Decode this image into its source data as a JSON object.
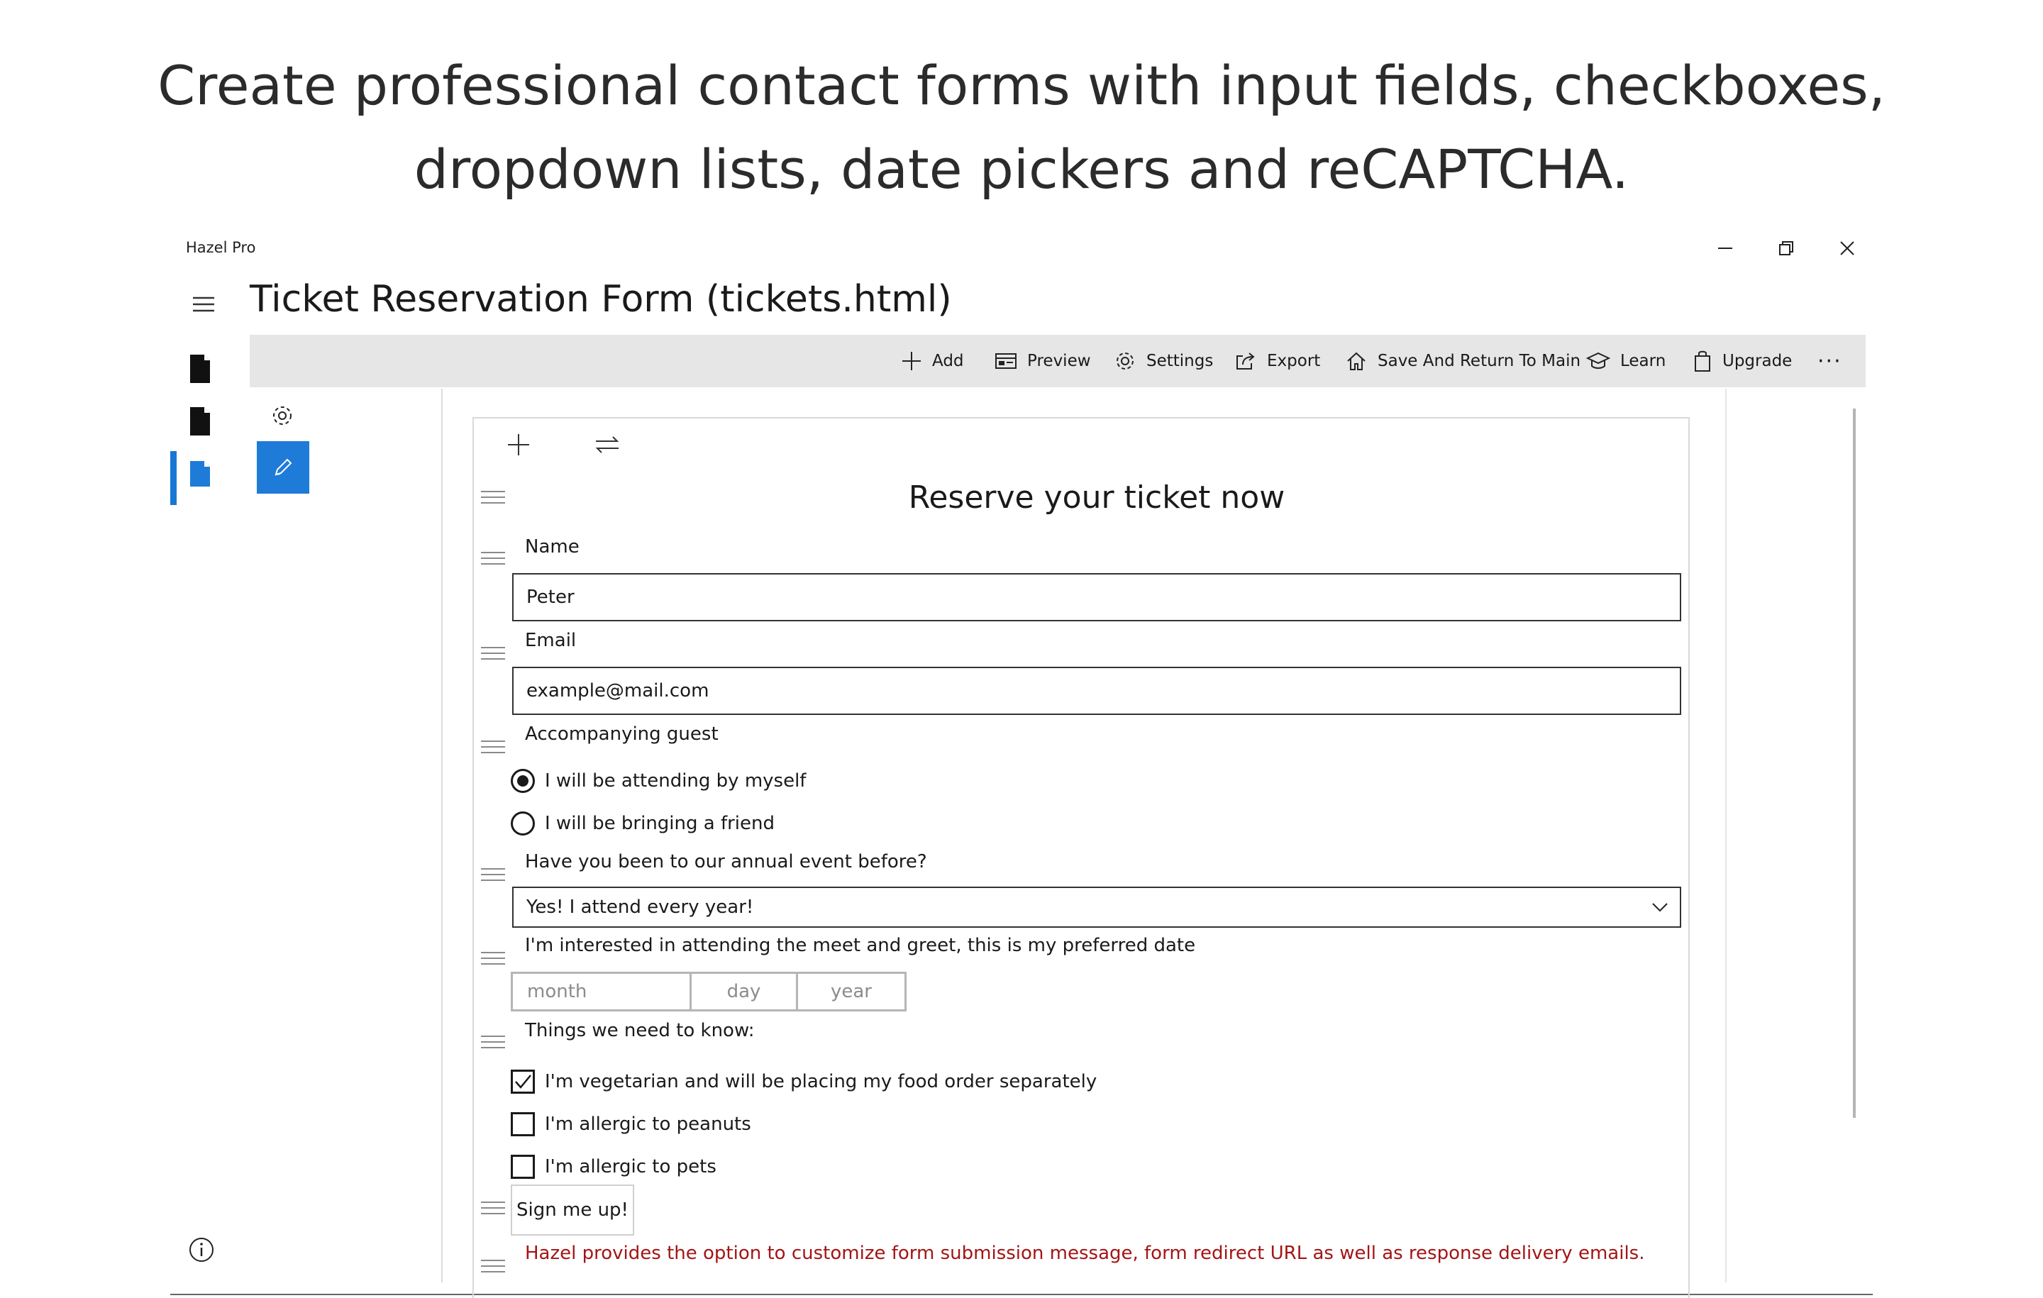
{
  "headline": {
    "line1": "Create professional contact forms with input fields, checkboxes,",
    "line2": "dropdown lists, date pickers and reCAPTCHA."
  },
  "window": {
    "app_title": "Hazel Pro",
    "page_title": "Ticket Reservation Form (tickets.html)"
  },
  "toolbar": {
    "add": "Add",
    "preview": "Preview",
    "settings": "Settings",
    "export": "Export",
    "save_return": "Save And Return To Main",
    "learn": "Learn",
    "upgrade": "Upgrade",
    "more": "···"
  },
  "form": {
    "title": "Reserve your ticket now",
    "name": {
      "label": "Name",
      "value": "Peter"
    },
    "email": {
      "label": "Email",
      "value": "example@mail.com"
    },
    "guest": {
      "label": "Accompanying guest",
      "options": [
        "I will be attending by myself",
        "I will be bringing a friend"
      ],
      "selected": 0
    },
    "event": {
      "label": "Have you been to our annual event before?",
      "selected": "Yes! I attend every year!"
    },
    "date": {
      "label": "I'm interested in attending the meet and greet, this is my preferred date",
      "month": "month",
      "day": "day",
      "year": "year"
    },
    "needs": {
      "label": "Things we need to know:",
      "options": [
        {
          "text": "I'm vegetarian and will be placing my food order separately",
          "checked": true
        },
        {
          "text": "I'm allergic to peanuts",
          "checked": false
        },
        {
          "text": "I'm allergic to pets",
          "checked": false
        }
      ]
    },
    "submit": "Sign me up!",
    "note": "Hazel provides the option to customize form submission message, form redirect URL as well as response delivery emails."
  },
  "colors": {
    "accent": "#1f7bd8",
    "note": "#a31515",
    "toolbar_bg": "#e6e6e6"
  }
}
